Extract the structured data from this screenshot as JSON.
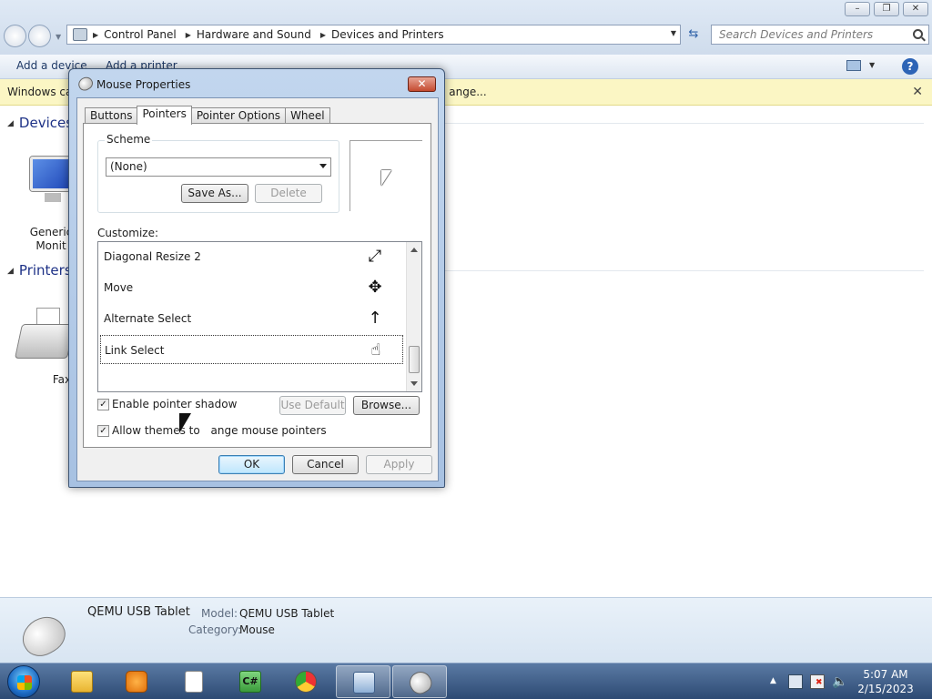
{
  "explorer": {
    "window_controls": [
      "–",
      "❐",
      "✕"
    ],
    "breadcrumbs": [
      "Control Panel",
      "Hardware and Sound",
      "Devices and Printers"
    ],
    "search_placeholder": "Search Devices and Printers",
    "commands": {
      "add_device": "Add a device",
      "add_printer": "Add a printer"
    },
    "info_bar": {
      "text_left": "Windows car",
      "text_right": "ange...",
      "close": "✕"
    },
    "groups": {
      "devices": "Devices",
      "printers": "Printers"
    },
    "devices": [
      {
        "label_line1": "Generic",
        "label_line2": "Monit"
      }
    ],
    "printers": [
      {
        "label": "Fax"
      }
    ],
    "details": {
      "device_name": "QEMU USB Tablet",
      "model_label": "Model:",
      "model_value": "QEMU USB Tablet",
      "category_label": "Category:",
      "category_value": "Mouse"
    }
  },
  "dialog": {
    "title": "Mouse Properties",
    "close": "✕",
    "tabs": [
      "Buttons",
      "Pointers",
      "Pointer Options",
      "Wheel"
    ],
    "active_tab": "Pointers",
    "scheme": {
      "group_title": "Scheme",
      "selected": "(None)",
      "save_as": "Save As...",
      "delete": "Delete"
    },
    "customize_label": "Customize:",
    "cursors": [
      {
        "name": "Diagonal Resize 2",
        "glyph": "⤢"
      },
      {
        "name": "Move",
        "glyph": "✥"
      },
      {
        "name": "Alternate Select",
        "glyph": "↑"
      },
      {
        "name": "Link Select",
        "glyph": "☝",
        "selected": true
      }
    ],
    "options": {
      "enable_shadow": {
        "label": "Enable pointer shadow",
        "checked": true
      },
      "allow_themes": {
        "label_start": "Allow themes to ",
        "label_end": "ange mouse pointers",
        "checked": true
      },
      "use_default": "Use Default",
      "browse": "Browse..."
    },
    "buttons": {
      "ok": "OK",
      "cancel": "Cancel",
      "apply": "Apply"
    }
  },
  "taskbar": {
    "clock_time": "5:07 AM",
    "clock_date": "2/15/2023",
    "icons": [
      "windows-explorer",
      "media-player",
      "notepad",
      "csharp-editor",
      "chrome",
      "devices-and-printers",
      "mouse"
    ]
  },
  "colors": {
    "accent": "#1e3287",
    "taskbar": "#2d4a73",
    "info_bar": "#fbf6c4",
    "close_red": "#c44a2f"
  }
}
